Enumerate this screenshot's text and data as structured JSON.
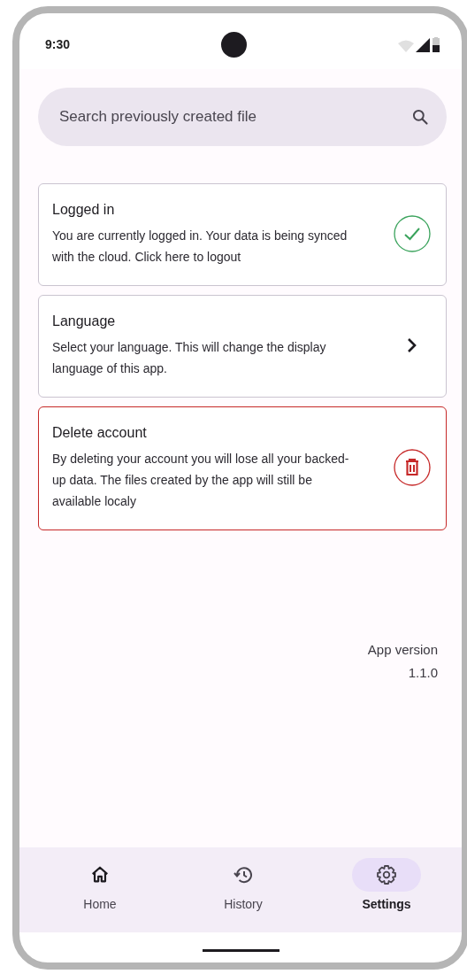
{
  "status_bar": {
    "time": "9:30"
  },
  "search": {
    "placeholder": "Search previously created file"
  },
  "settings": [
    {
      "kind": "check",
      "title": "Logged in",
      "description": "You are currently logged in. Your data is being synced with the cloud. Click here to logout"
    },
    {
      "kind": "chevron",
      "title": "Language",
      "description": "Select your language. This will change the display language of this app."
    },
    {
      "kind": "delete",
      "title": "Delete account",
      "description": "By deleting your account you will lose all your backed-up data. The files created by the app will still be available localy"
    }
  ],
  "app_version": {
    "label": "App version",
    "value": "1.1.0"
  },
  "nav": [
    {
      "kind": "home",
      "label": "Home",
      "selected": false
    },
    {
      "kind": "history",
      "label": "History",
      "selected": false
    },
    {
      "kind": "settings",
      "label": "Settings",
      "selected": true
    }
  ]
}
